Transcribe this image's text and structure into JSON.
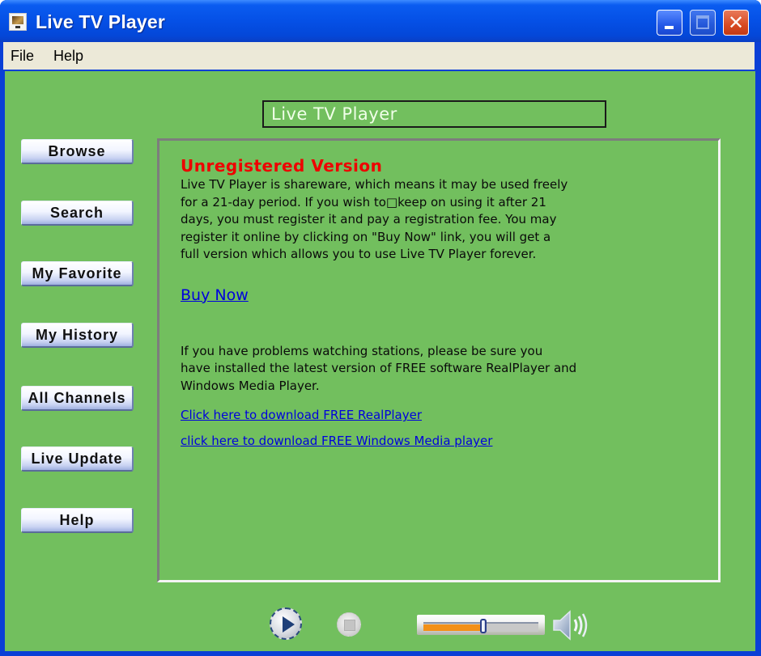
{
  "window": {
    "title": "Live TV Player",
    "icon": "tv-monitor-icon",
    "controls": {
      "minimize": "minimize-icon",
      "maximize": "maximize-icon",
      "close_glyph": "✕"
    }
  },
  "menubar": {
    "items": [
      "File",
      "Help"
    ]
  },
  "header": {
    "title": "Live TV Player"
  },
  "sidebar": {
    "buttons": [
      "Browse",
      "Search",
      "My Favorite",
      "My History",
      "All Channels",
      "Live Update",
      "Help"
    ]
  },
  "content": {
    "warning_title": "Unregistered Version",
    "warning_text": "Live TV Player is shareware, which means it may be used freely for a 21-day period. If you wish to□keep on using it after 21 days, you must register it and pay a registration fee. You may register it online by clicking on \"Buy Now\" link, you will get a full version which allows you to use Live TV Player forever.",
    "warning_lines": [
      "Live TV Player is shareware, which means it may be used freely",
      "for a 21-day period. If you wish to□keep on using it after 21",
      "days, you must register it and pay a registration fee. You may",
      "register it online by clicking on \"Buy Now\" link, you will get a",
      "full version which allows you to use Live TV Player forever."
    ],
    "buy_now_link": "Buy Now",
    "help_lines": [
      "If you have problems watching stations, please be sure you",
      "have installed the latest version of FREE software RealPlayer and",
      "Windows Media Player."
    ],
    "realplayer_link": "Click here to download FREE RealPlayer",
    "wmp_link": "click here to download FREE Windows Media player"
  },
  "player": {
    "play_icon": "play-icon",
    "stop_icon": "stop-icon",
    "volume_percent": 52,
    "speaker_icon": "speaker-icon"
  },
  "colors": {
    "client_bg": "#72bf5e",
    "warning": "#ee0000",
    "link": "#0000dd",
    "title_bar": "#0550e6",
    "volume_fill": "#f39018"
  }
}
